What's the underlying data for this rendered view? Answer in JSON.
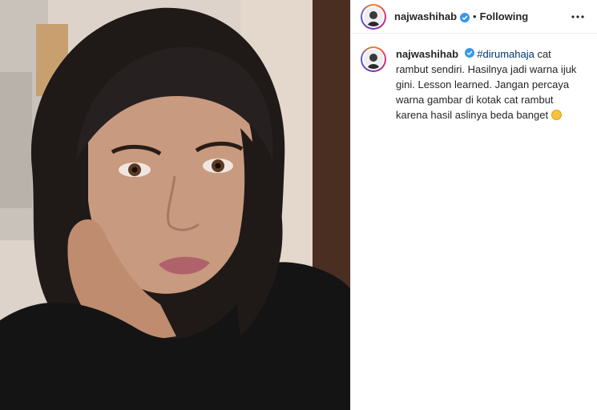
{
  "post": {
    "username": "najwashihab",
    "dot": "•",
    "follow_status": "Following",
    "caption": {
      "hashtag": "#dirumahaja",
      "text": " cat rambut sendiri. Hasilnya jadi warna ijuk gini. Lesson learned. Jangan percaya warna gambar di kotak cat rambut karena hasil aslinya beda banget",
      "emoji": "flushed-face"
    }
  },
  "icons": {
    "verified": "verified-badge-icon",
    "more": "more-options-icon"
  },
  "colors": {
    "verified_blue": "#3897f0",
    "hashtag": "#00376b",
    "text": "#262626",
    "border": "#efefef"
  }
}
